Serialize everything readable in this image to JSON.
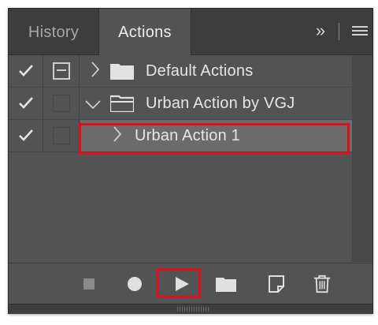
{
  "tabs": [
    {
      "label": "History",
      "active": false
    },
    {
      "label": "Actions",
      "active": true
    }
  ],
  "tab_controls": {
    "more_icon": "double-chevron-right-icon",
    "menu_icon": "hamburger-menu-icon"
  },
  "actions": [
    {
      "label": "Default Actions",
      "type": "set",
      "expanded": false,
      "checked": true,
      "dialog_toggle": true
    },
    {
      "label": "Urban Action by VGJ",
      "type": "set",
      "expanded": true,
      "checked": true,
      "dialog_toggle": false
    },
    {
      "label": "Urban Action 1",
      "type": "action",
      "expanded": false,
      "checked": true,
      "dialog_toggle": false,
      "selected": true
    }
  ],
  "toolbar": [
    "stop-recording",
    "begin-recording",
    "play-selection",
    "create-new-set",
    "create-new-action",
    "delete"
  ],
  "colors": {
    "panel": "#535353",
    "tabbar": "#3d3d3d",
    "selection": "#6b6b6b",
    "highlight": "#e0101a",
    "text": "#e6e6e6"
  }
}
